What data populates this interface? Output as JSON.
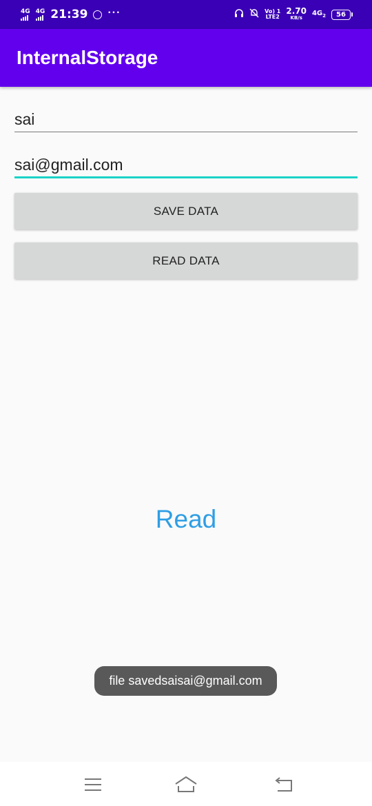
{
  "status_bar": {
    "sim1": "4G",
    "sim2": "4G",
    "time": "21:39",
    "more": "···",
    "volte_top": "Vo) 1",
    "volte_bottom": "LTE2",
    "speed_value": "2.70",
    "speed_unit": "KB/s",
    "network": "4G",
    "network_sub": "2",
    "battery": "56",
    "icons": [
      "signal-icon",
      "whatsapp-icon",
      "headphones-icon",
      "mute-bell-icon",
      "battery-icon"
    ]
  },
  "app_bar": {
    "title": "InternalStorage",
    "color": "#6200ee"
  },
  "form": {
    "name_value": "sai",
    "email_value": "sai@gmail.com",
    "save_label": "SAVE DATA",
    "read_label": "READ DATA",
    "accent": "#1ad3c8"
  },
  "content": {
    "read_text": "Read",
    "read_color": "#2f9ee4"
  },
  "toast": {
    "message": "file savedsaisai@gmail.com"
  },
  "nav_bar": {
    "icons": [
      "menu-icon",
      "home-icon",
      "back-icon"
    ]
  }
}
